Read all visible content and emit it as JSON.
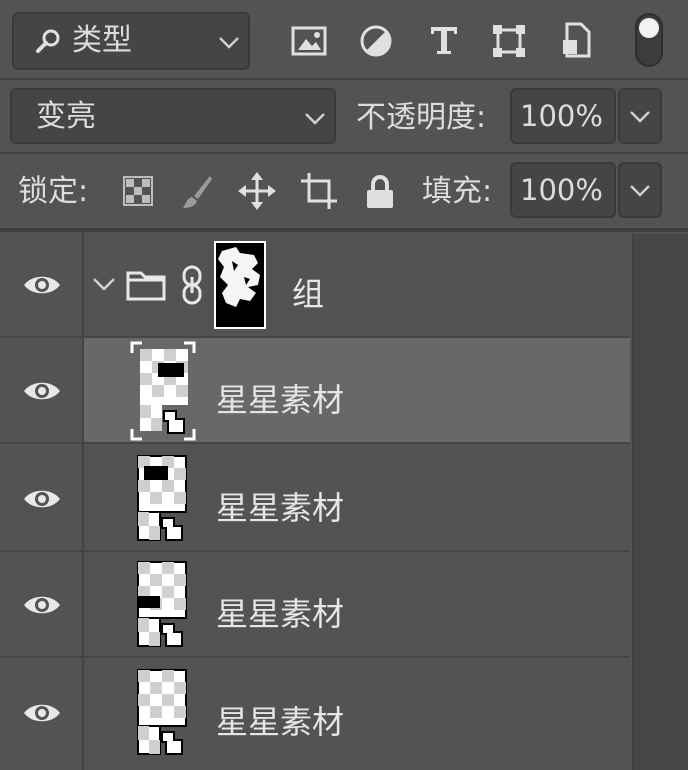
{
  "filter": {
    "selected": "类型",
    "icons": [
      "image-filter-icon",
      "adjustment-filter-icon",
      "type-filter-icon",
      "shape-filter-icon",
      "smart-object-filter-icon"
    ]
  },
  "blend": {
    "mode": "变亮",
    "opacity_label": "不透明度:",
    "opacity_value": "100%"
  },
  "lock": {
    "label": "锁定:",
    "fill_label": "填充:",
    "fill_value": "100%"
  },
  "layers": {
    "group": {
      "name": "组"
    },
    "items": [
      {
        "name": "星星素材",
        "selected": true
      },
      {
        "name": "星星素材",
        "selected": false
      },
      {
        "name": "星星素材",
        "selected": false
      },
      {
        "name": "星星素材",
        "selected": false
      }
    ]
  },
  "colors": {
    "panel_bg": "#535353",
    "control_bg": "#454545",
    "selected_row": "#686868",
    "text": "#dcdcdc"
  }
}
